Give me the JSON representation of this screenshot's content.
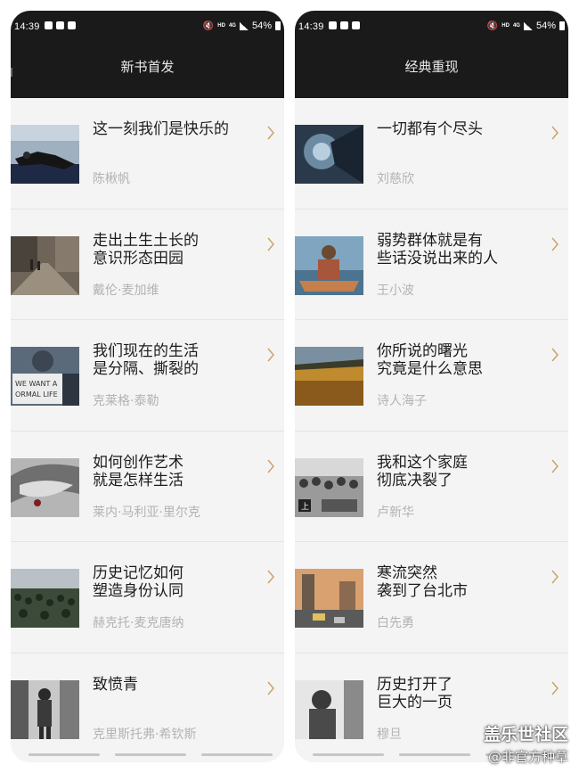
{
  "status": {
    "time": "14:39",
    "battery": "54%",
    "network": "4G",
    "hd": "HD"
  },
  "left": {
    "title": "新书首发",
    "items": [
      {
        "title": "这一刻我们是快乐的",
        "author": "陈楸帆"
      },
      {
        "title": "走出土生土长的\n意识形态田园",
        "author": "戴伦·麦加维"
      },
      {
        "title": "我们现在的生活\n是分隔、撕裂的",
        "author": "克莱格·泰勒"
      },
      {
        "title": "如何创作艺术\n就是怎样生活",
        "author": "莱内·马利亚·里尔克"
      },
      {
        "title": "历史记忆如何\n塑造身份认同",
        "author": "赫克托·麦克唐纳"
      },
      {
        "title": "致愤青",
        "author": "克里斯托弗·希钦斯"
      }
    ]
  },
  "right": {
    "title": "经典重现",
    "items": [
      {
        "title": "一切都有个尽头",
        "author": "刘慈欣"
      },
      {
        "title": "弱势群体就是有\n些话没说出来的人",
        "author": "王小波"
      },
      {
        "title": "你所说的曙光\n究竟是什么意思",
        "author": "诗人海子"
      },
      {
        "title": "我和这个家庭\n彻底决裂了",
        "author": "卢新华"
      },
      {
        "title": "寒流突然\n袭到了台北市",
        "author": "白先勇"
      },
      {
        "title": "历史打开了\n巨大的一页",
        "author": "穆旦"
      }
    ]
  },
  "watermark": {
    "line1": "盖乐世社区",
    "line2": "@非官方种草"
  },
  "colors": {
    "header_bg": "#1a1a1a",
    "list_bg": "#f4f4f4",
    "author_text": "#b3b3b3",
    "chevron": "#c9a063"
  }
}
